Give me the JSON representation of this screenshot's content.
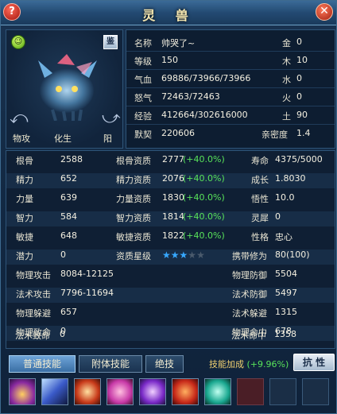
{
  "window": {
    "title": "灵 兽",
    "help": "?",
    "close": "✕"
  },
  "portrait": {
    "jian": "鉴",
    "buttons": [
      "物攻",
      "化生",
      "阳"
    ]
  },
  "info": {
    "name_label": "名称",
    "name_value": "帅哭了~",
    "level_label": "等级",
    "level_value": "150",
    "hp_label": "气血",
    "hp_value": "69886/73966/73966",
    "rage_label": "怒气",
    "rage_value": "72463/72463",
    "exp_label": "经验",
    "exp_value": "412664/302616000",
    "bond_label": "默契",
    "bond_value": "220606",
    "gold_label": "金",
    "gold_value": "0",
    "wood_label": "木",
    "wood_value": "10",
    "water_label": "水",
    "water_value": "0",
    "fire_label": "火",
    "fire_value": "0",
    "earth_label": "土",
    "earth_value": "90",
    "intimacy_label": "亲密度",
    "intimacy_value": "1.4"
  },
  "stats": {
    "rows": [
      {
        "a_label": "根骨",
        "a_value": "2588",
        "b_label": "根骨资质",
        "b_value": "2777",
        "b_bonus": "(+40.0%)",
        "c_label": "寿命",
        "c_value": "4375/5000"
      },
      {
        "a_label": "精力",
        "a_value": "652",
        "b_label": "精力资质",
        "b_value": "2076",
        "b_bonus": "(+40.0%)",
        "c_label": "成长",
        "c_value": "1.8030"
      },
      {
        "a_label": "力量",
        "a_value": "639",
        "b_label": "力量资质",
        "b_value": "1830",
        "b_bonus": "(+40.0%)",
        "c_label": "悟性",
        "c_value": "10.0"
      },
      {
        "a_label": "智力",
        "a_value": "584",
        "b_label": "智力资质",
        "b_value": "1814",
        "b_bonus": "(+40.0%)",
        "c_label": "灵犀",
        "c_value": "0"
      },
      {
        "a_label": "敏捷",
        "a_value": "648",
        "b_label": "敏捷资质",
        "b_value": "1822",
        "b_bonus": "(+40.0%)",
        "c_label": "性格",
        "c_value": "忠心"
      }
    ],
    "potential_label": "潜力",
    "potential_value": "0",
    "star_label": "资质星级",
    "stars_filled": 3,
    "stars_total": 5,
    "cultivation_label": "携带修为",
    "cultivation_value": "80(100)",
    "combat": [
      {
        "l_label": "物理攻击",
        "l_value": "8084-12125",
        "r_label": "物理防御",
        "r_value": "5504"
      },
      {
        "l_label": "法术攻击",
        "l_value": "7796-11694",
        "r_label": "法术防御",
        "r_value": "5497"
      },
      {
        "l_label": "物理躲避",
        "l_value": "657",
        "r_label": "法术躲避",
        "r_value": "1315"
      },
      {
        "l_label": "物理致命",
        "l_value": "0",
        "r_label": "物理命中",
        "r_value": "678"
      },
      {
        "l_label": "法术致命",
        "l_value": "0",
        "r_label": "法术命中",
        "r_value": "1358"
      }
    ]
  },
  "tabs": [
    "普通技能",
    "附体技能",
    "绝技"
  ],
  "bonus_label": "技能加成",
  "bonus_value": "(+9.96%)",
  "resist_button": "抗 性",
  "colors": {
    "accent_green": "#58e35a",
    "star_blue": "#37a8ff",
    "bonus_gold": "#f0d070"
  }
}
